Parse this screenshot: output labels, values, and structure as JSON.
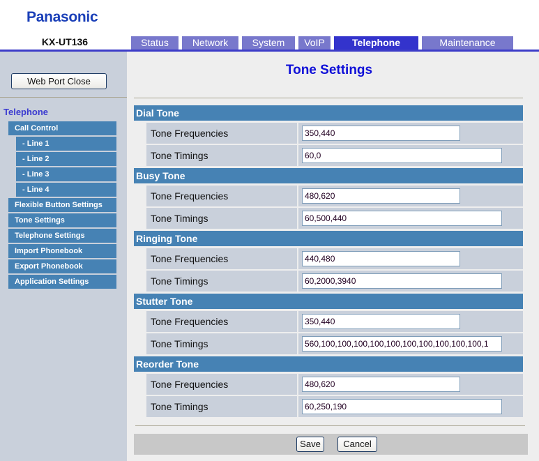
{
  "brand": {
    "logo": "Panasonic",
    "model": "KX-UT136",
    "brand_color": "#1a3fb8"
  },
  "tabs": [
    {
      "label": "Status",
      "active": false
    },
    {
      "label": "Network",
      "active": false
    },
    {
      "label": "System",
      "active": false
    },
    {
      "label": "VoIP",
      "active": false
    },
    {
      "label": "Telephone",
      "active": true
    },
    {
      "label": "Maintenance",
      "active": false
    }
  ],
  "sidebar": {
    "web_port_close": "Web Port Close",
    "section_title": "Telephone",
    "items": [
      {
        "label": "Call Control",
        "sub": false
      },
      {
        "label": "- Line 1",
        "sub": true
      },
      {
        "label": "- Line 2",
        "sub": true
      },
      {
        "label": "- Line 3",
        "sub": true
      },
      {
        "label": "- Line 4",
        "sub": true
      },
      {
        "label": "Flexible Button Settings",
        "sub": false
      },
      {
        "label": "Tone Settings",
        "sub": false
      },
      {
        "label": "Telephone Settings",
        "sub": false
      },
      {
        "label": "Import Phonebook",
        "sub": false
      },
      {
        "label": "Export Phonebook",
        "sub": false
      },
      {
        "label": "Application Settings",
        "sub": false
      }
    ]
  },
  "main": {
    "title": "Tone Settings",
    "sections": [
      {
        "title": "Dial Tone",
        "rows": [
          {
            "label": "Tone Frequencies",
            "value": "350,440"
          },
          {
            "label": "Tone Timings",
            "value": "60,0"
          }
        ]
      },
      {
        "title": "Busy Tone",
        "rows": [
          {
            "label": "Tone Frequencies",
            "value": "480,620"
          },
          {
            "label": "Tone Timings",
            "value": "60,500,440"
          }
        ]
      },
      {
        "title": "Ringing Tone",
        "rows": [
          {
            "label": "Tone Frequencies",
            "value": "440,480"
          },
          {
            "label": "Tone Timings",
            "value": "60,2000,3940"
          }
        ]
      },
      {
        "title": "Stutter Tone",
        "rows": [
          {
            "label": "Tone Frequencies",
            "value": "350,440"
          },
          {
            "label": "Tone Timings",
            "value": "560,100,100,100,100,100,100,100,100,100,100,1"
          }
        ]
      },
      {
        "title": "Reorder Tone",
        "rows": [
          {
            "label": "Tone Frequencies",
            "value": "480,620"
          },
          {
            "label": "Tone Timings",
            "value": "60,250,190"
          }
        ]
      }
    ],
    "save_label": "Save",
    "cancel_label": "Cancel"
  },
  "colors": {
    "section_header": "#4682b4",
    "active_tab": "#3333cc",
    "inactive_tab": "#7878cc",
    "title": "#1010d8"
  }
}
